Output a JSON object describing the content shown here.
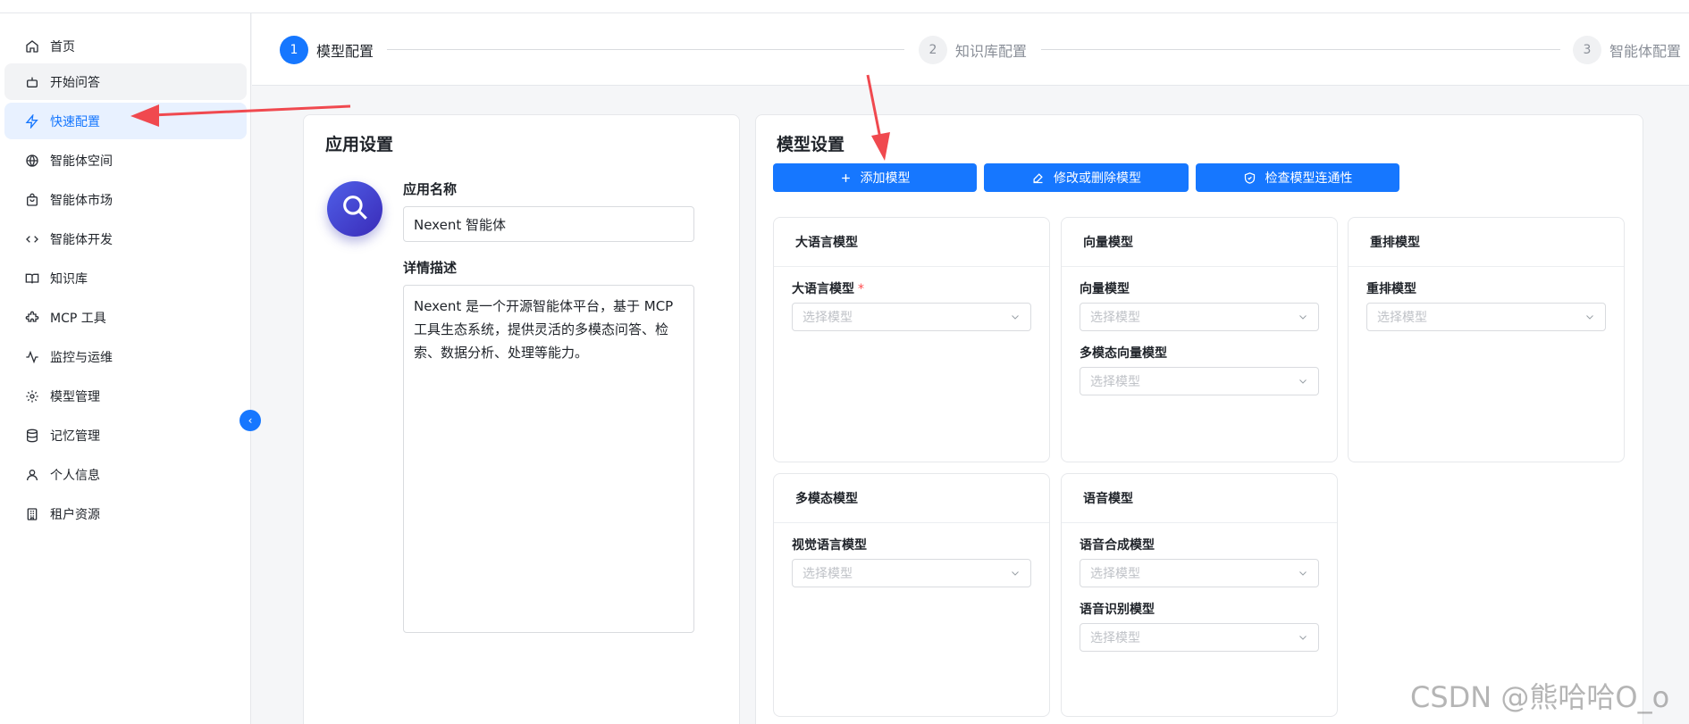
{
  "sidebar": {
    "items": [
      {
        "label": "首页",
        "icon": "home-icon"
      },
      {
        "label": "开始问答",
        "icon": "bot-icon"
      },
      {
        "label": "快速配置",
        "icon": "zap-icon"
      },
      {
        "label": "智能体空间",
        "icon": "globe-icon"
      },
      {
        "label": "智能体市场",
        "icon": "store-bag-icon"
      },
      {
        "label": "智能体开发",
        "icon": "code-icon"
      },
      {
        "label": "知识库",
        "icon": "book-icon"
      },
      {
        "label": "MCP 工具",
        "icon": "puzzle-icon"
      },
      {
        "label": "监控与运维",
        "icon": "activity-icon"
      },
      {
        "label": "模型管理",
        "icon": "gear-icon"
      },
      {
        "label": "记忆管理",
        "icon": "database-icon"
      },
      {
        "label": "个人信息",
        "icon": "user-icon"
      },
      {
        "label": "租户资源",
        "icon": "building-icon"
      }
    ],
    "active_index": 2,
    "hover_index": 1,
    "collapse_icon": "chevron-left-icon"
  },
  "steps": [
    {
      "num": "1",
      "label": "模型配置",
      "state": "active"
    },
    {
      "num": "2",
      "label": "知识库配置",
      "state": "pending"
    },
    {
      "num": "3",
      "label": "智能体配置",
      "state": "pending"
    }
  ],
  "app_settings": {
    "title": "应用设置",
    "avatar_icon": "search-icon",
    "name_label": "应用名称",
    "name_value": "Nexent 智能体",
    "desc_label": "详情描述",
    "desc_value": "Nexent 是一个开源智能体平台，基于 MCP 工具生态系统，提供灵活的多模态问答、检索、数据分析、处理等能力。"
  },
  "model_settings": {
    "title": "模型设置",
    "buttons": [
      {
        "label": "添加模型",
        "icon": "plus-icon"
      },
      {
        "label": "修改或删除模型",
        "icon": "edit-icon"
      },
      {
        "label": "检查模型连通性",
        "icon": "shield-check-icon"
      }
    ],
    "groups": {
      "llm": {
        "title": "大语言模型",
        "fields": [
          {
            "label": "大语言模型",
            "required": "*",
            "placeholder": "选择模型"
          }
        ]
      },
      "embedding": {
        "title": "向量模型",
        "fields": [
          {
            "label": "向量模型",
            "placeholder": "选择模型"
          },
          {
            "label": "多模态向量模型",
            "placeholder": "选择模型"
          }
        ]
      },
      "rerank": {
        "title": "重排模型",
        "fields": [
          {
            "label": "重排模型",
            "placeholder": "选择模型"
          }
        ]
      },
      "multimodal": {
        "title": "多模态模型",
        "fields": [
          {
            "label": "视觉语言模型",
            "placeholder": "选择模型"
          }
        ]
      },
      "voice": {
        "title": "语音模型",
        "fields": [
          {
            "label": "语音合成模型",
            "placeholder": "选择模型"
          },
          {
            "label": "语音识别模型",
            "placeholder": "选择模型"
          }
        ]
      }
    }
  },
  "colors": {
    "primary": "#1677ff",
    "active_bg": "#e8f1ff",
    "annotation_arrow": "#f0494f"
  },
  "watermark": "CSDN @熊哈哈O_o"
}
